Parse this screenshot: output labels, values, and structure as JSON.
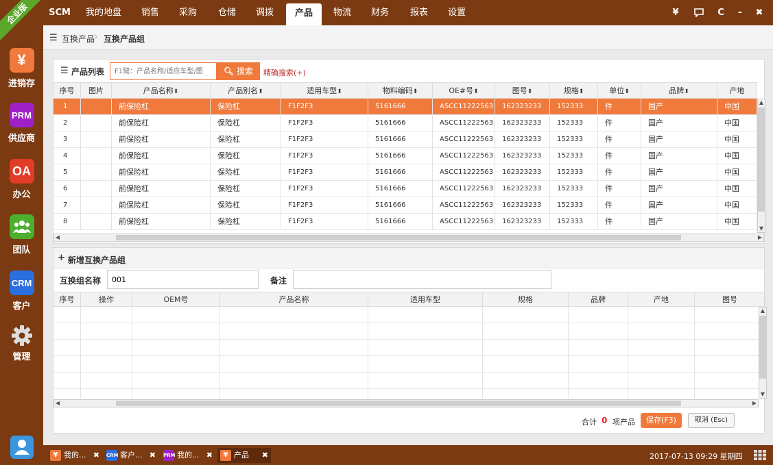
{
  "sidebar": {
    "badge": "企业版",
    "items": [
      {
        "icon": "¥",
        "label": "进销存",
        "color": "#f07a3c"
      },
      {
        "icon": "PRM",
        "label": "供应商",
        "color": "#a020c8"
      },
      {
        "icon": "OA",
        "label": "办公",
        "color": "#e03c28"
      },
      {
        "icon": "team",
        "label": "团队",
        "color": "#4caf2e"
      },
      {
        "icon": "CRM",
        "label": "客户",
        "color": "#2a6ee0"
      },
      {
        "icon": "gear",
        "label": "管理",
        "color": "transparent"
      }
    ]
  },
  "topbar": {
    "brand": "SCM",
    "nav": [
      "我的地盘",
      "销售",
      "采购",
      "仓储",
      "调拨",
      "产品",
      "物流",
      "财务",
      "报表",
      "设置"
    ],
    "active": "产品",
    "controls": [
      "¥",
      "💬",
      "C",
      "–",
      "✖"
    ]
  },
  "breadcrumb": {
    "items": [
      "互换产品",
      "互换产品组"
    ]
  },
  "product_list": {
    "title": "产品列表",
    "search_placeholder": "F1键：产品名称/适应车型/图",
    "search_button": "搜索",
    "advanced": "精确搜索(+)",
    "columns": [
      "序号",
      "图片",
      "产品名称",
      "产品别名",
      "适用车型",
      "物料编码",
      "OE#号",
      "图号",
      "规格",
      "单位",
      "品牌",
      "产地"
    ],
    "rows": [
      [
        "1",
        "",
        "前保险杠",
        "保险杠",
        "F1F2F3",
        "5161666",
        "ASCC11222563",
        "162323233",
        "152333",
        "件",
        "国产",
        "中国"
      ],
      [
        "2",
        "",
        "前保险杠",
        "保险杠",
        "F1F2F3",
        "5161666",
        "ASCC11222563",
        "162323233",
        "152333",
        "件",
        "国产",
        "中国"
      ],
      [
        "3",
        "",
        "前保险杠",
        "保险杠",
        "F1F2F3",
        "5161666",
        "ASCC11222563",
        "162323233",
        "152333",
        "件",
        "国产",
        "中国"
      ],
      [
        "4",
        "",
        "前保险杠",
        "保险杠",
        "F1F2F3",
        "5161666",
        "ASCC11222563",
        "162323233",
        "152333",
        "件",
        "国产",
        "中国"
      ],
      [
        "5",
        "",
        "前保险杠",
        "保险杠",
        "F1F2F3",
        "5161666",
        "ASCC11222563",
        "162323233",
        "152333",
        "件",
        "国产",
        "中国"
      ],
      [
        "6",
        "",
        "前保险杠",
        "保险杠",
        "F1F2F3",
        "5161666",
        "ASCC11222563",
        "162323233",
        "152333",
        "件",
        "国产",
        "中国"
      ],
      [
        "7",
        "",
        "前保险杠",
        "保险杠",
        "F1F2F3",
        "5161666",
        "ASCC11222563",
        "162323233",
        "152333",
        "件",
        "国产",
        "中国"
      ],
      [
        "8",
        "",
        "前保险杠",
        "保险杠",
        "F1F2F3",
        "5161666",
        "ASCC11222563",
        "162323233",
        "152333",
        "件",
        "国产",
        "中国"
      ]
    ]
  },
  "new_group": {
    "title": "新增互换产品组",
    "name_label": "互换组名称",
    "name_value": "001",
    "remark_label": "备注",
    "remark_value": "",
    "columns": [
      "序号",
      "操作",
      "OEM号",
      "产品名称",
      "适用车型",
      "规格",
      "品牌",
      "产地",
      "图号"
    ]
  },
  "footer": {
    "total_label": "合计",
    "total_count": "0",
    "total_unit": "项产品",
    "save": "保存(F3)",
    "cancel": "取消 (Esc)"
  },
  "taskbar": {
    "tabs": [
      {
        "icon": "¥",
        "label": "我的...",
        "color": "#f07a3c"
      },
      {
        "icon": "CRM",
        "label": "客户...",
        "color": "#2a6ee0"
      },
      {
        "icon": "PRM",
        "label": "我的...",
        "color": "#a020c8"
      },
      {
        "icon": "¥",
        "label": "产品",
        "color": "#f07a3c"
      }
    ],
    "datetime": "2017-07-13 09:29 星期四"
  }
}
